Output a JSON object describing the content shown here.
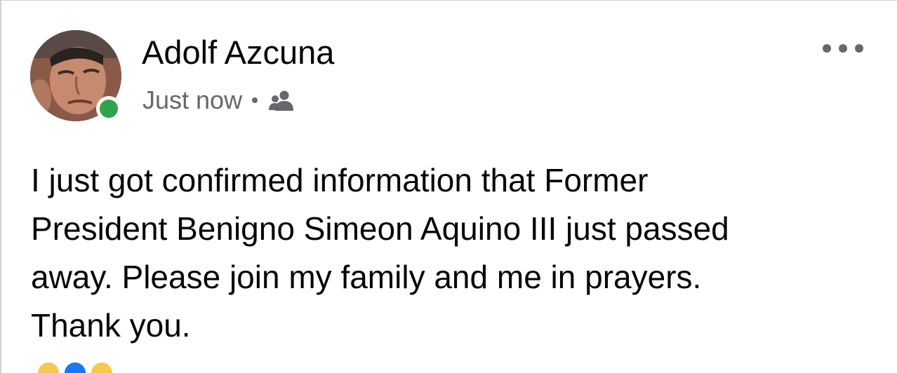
{
  "post": {
    "author": {
      "name": "Adolf Azcuna",
      "online": true
    },
    "timestamp": "Just now",
    "audience_icon": "friends-icon",
    "more_icon": "more-horizontal-icon",
    "text": "I just got confirmed information that Former\nPresident Benigno Simeon Aquino III just passed\naway.  Please join my family and me in prayers.\nThank you."
  },
  "colors": {
    "presence": "#31a24c",
    "secondary_text": "#65676b",
    "primary_text": "#050505"
  }
}
